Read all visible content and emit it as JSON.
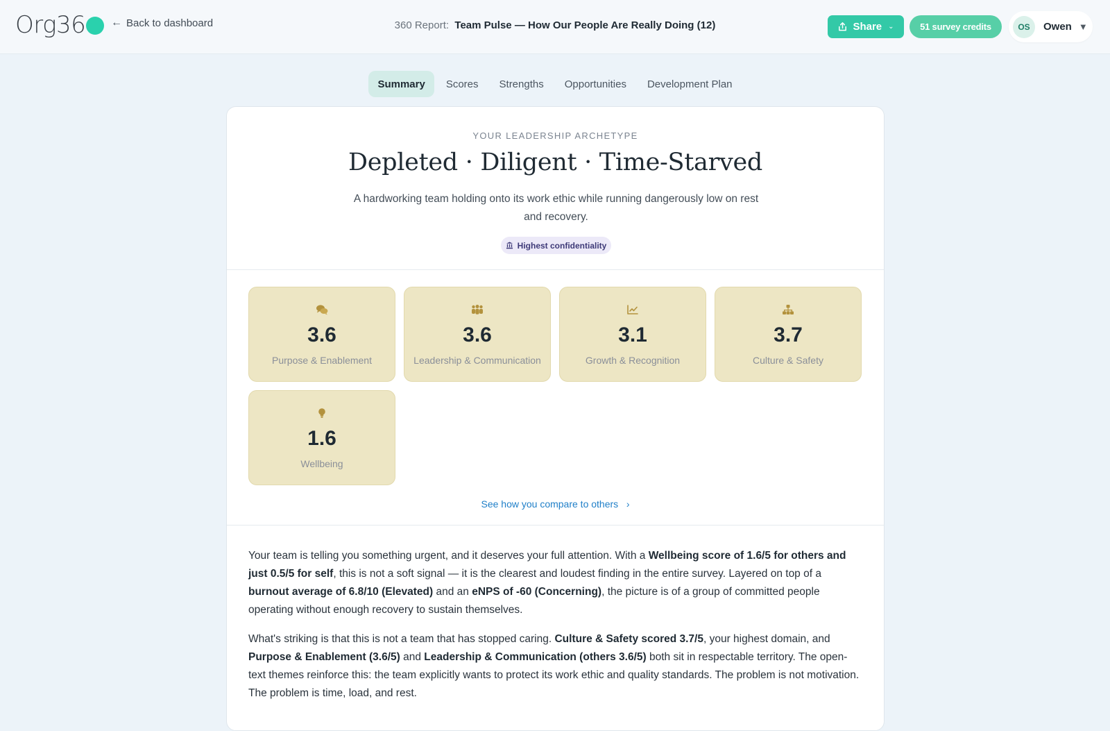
{
  "header": {
    "logo_text": "Org36",
    "back_label": "Back to dashboard",
    "report_prefix": "360 Report:",
    "report_name": "Team Pulse — How Our People Are Really Doing (12)",
    "share_label": "Share",
    "credits_label": "51 survey credits",
    "user_initials": "OS",
    "user_name": "Owen"
  },
  "tabs": [
    {
      "label": "Summary",
      "active": true
    },
    {
      "label": "Scores",
      "active": false
    },
    {
      "label": "Strengths",
      "active": false
    },
    {
      "label": "Opportunities",
      "active": false
    },
    {
      "label": "Development Plan",
      "active": false
    }
  ],
  "archetype": {
    "eyebrow": "YOUR LEADERSHIP ARCHETYPE",
    "title": "Depleted · Diligent · Time-Starved",
    "description": "A hardworking team holding onto its work ethic while running dangerously low on rest and recovery.",
    "badge": "Highest confidentiality"
  },
  "scores": [
    {
      "value": "3.6",
      "label": "Purpose & Enablement",
      "icon": "chat-bubbles-icon"
    },
    {
      "value": "3.6",
      "label": "Leadership & Communication",
      "icon": "people-group-icon"
    },
    {
      "value": "3.1",
      "label": "Growth & Recognition",
      "icon": "line-chart-icon"
    },
    {
      "value": "3.7",
      "label": "Culture & Safety",
      "icon": "org-chart-icon"
    },
    {
      "value": "1.6",
      "label": "Wellbeing",
      "icon": "lightbulb-icon"
    }
  ],
  "compare_link": "See how you compare to others",
  "summary": {
    "p1": {
      "t1": "Your team is telling you something urgent, and it deserves your full attention. With a ",
      "b1": "Wellbeing score of 1.6/5 for others and just 0.5/5 for self",
      "t2": ", this is not a soft signal — it is the clearest and loudest finding in the entire survey. Layered on top of a ",
      "b2": "burnout average of 6.8/10 (Elevated)",
      "t3": " and an ",
      "b3": "eNPS of -60 (Concerning)",
      "t4": ", the picture is of a group of committed people operating without enough recovery to sustain themselves."
    },
    "p2": {
      "t1": "What's striking is that this is not a team that has stopped caring. ",
      "b1": "Culture & Safety scored 3.7/5",
      "t2": ", your highest domain, and ",
      "b2": "Purpose & Enablement (3.6/5)",
      "t3": " and ",
      "b3": "Leadership & Communication (others 3.6/5)",
      "t4": " both sit in respectable territory. The open-text themes reinforce this: the team explicitly wants to protect its work ethic and quality standards. The problem is not motivation. The problem is time, load, and rest."
    }
  },
  "colors": {
    "brand": "#2ad1ad",
    "share": "#33c9a7",
    "credits": "#57cfa7",
    "tile_bg": "#ede6c4",
    "tile_icon": "#b3923d",
    "link": "#1f7fc8"
  }
}
